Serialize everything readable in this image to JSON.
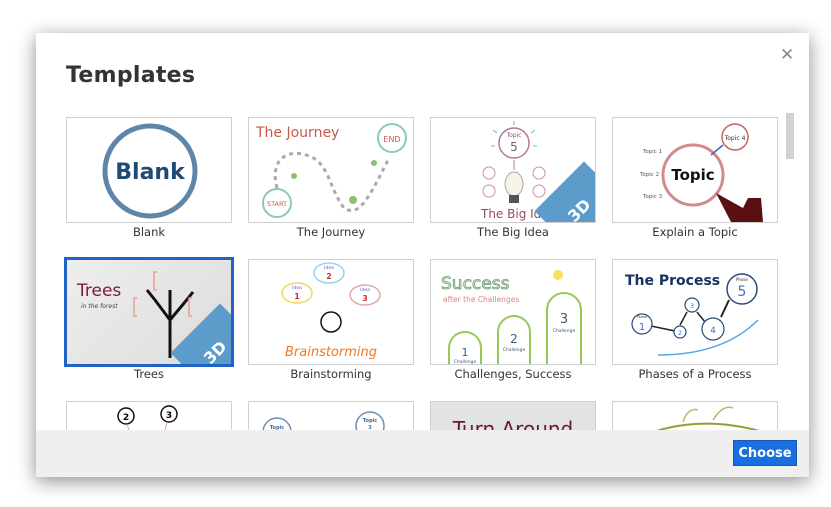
{
  "dialog": {
    "title": "Templates",
    "close_icon": "close-icon",
    "choose_label": "Choose"
  },
  "templates": [
    {
      "label": "Blank",
      "thumb_text": "Blank",
      "badge": ""
    },
    {
      "label": "The Journey",
      "thumb_text": "The Journey",
      "start": "START",
      "end": "END",
      "badge": ""
    },
    {
      "label": "The Big Idea",
      "thumb_text": "The Big Idea",
      "topic": "Topic",
      "topic_num": "5",
      "badge": "3D"
    },
    {
      "label": "Explain a Topic",
      "thumb_text": "Topic",
      "topic4": "Topic 4",
      "topic1": "Topic 1",
      "topic2": "Topic 2",
      "topic3": "Topic 3",
      "badge": ""
    },
    {
      "label": "Trees",
      "thumb_text": "Trees",
      "subtitle": "in the forest",
      "badge": "3D",
      "selected": true
    },
    {
      "label": "Brainstorming",
      "thumb_text": "Brainstorming",
      "idea": "Idea",
      "ideas": [
        "1",
        "2",
        "3"
      ],
      "badge": ""
    },
    {
      "label": "Challenges, Success",
      "thumb_text": "Success",
      "subtitle": "after the Challenges",
      "challenge": "Challenge",
      "nums": [
        "1",
        "2",
        "3"
      ],
      "badge": ""
    },
    {
      "label": "Phases of a Process",
      "thumb_text": "The Process",
      "phase": "Phase",
      "nums": [
        "1",
        "2",
        "3",
        "4",
        "5"
      ],
      "badge": ""
    },
    {
      "label": "",
      "nums": [
        "2",
        "3"
      ]
    },
    {
      "label": "",
      "topic": "Topic",
      "topic_num": "3"
    },
    {
      "label": "",
      "thumb_text": "Turn Around"
    },
    {
      "label": ""
    }
  ]
}
